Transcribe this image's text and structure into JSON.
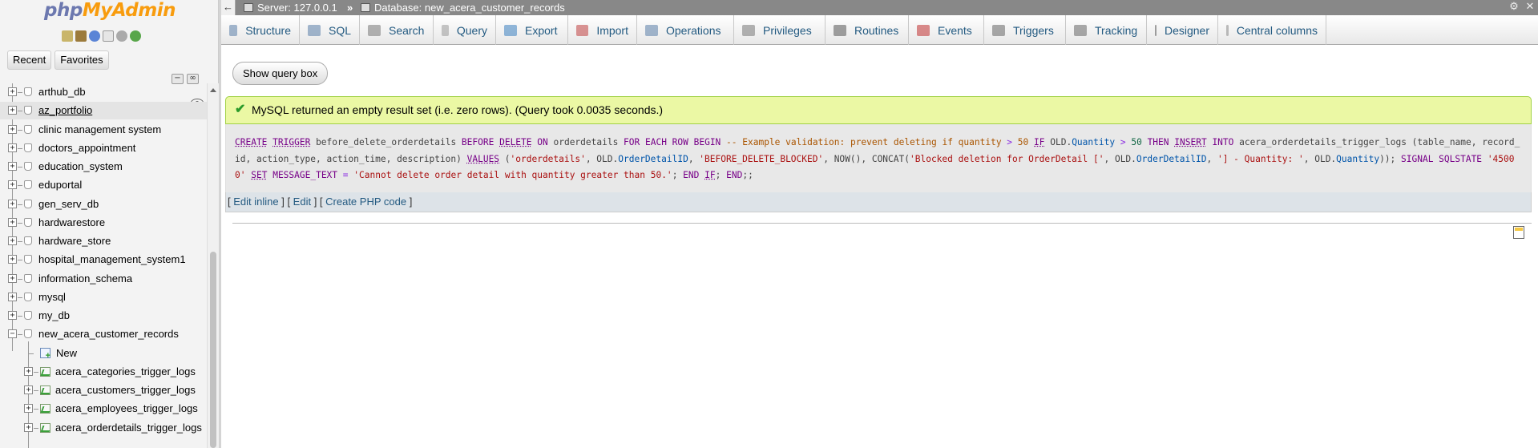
{
  "logo": {
    "part1": "php",
    "part2": "MyAdmin"
  },
  "nav": {
    "recent_label": "Recent",
    "favorites_label": "Favorites",
    "databases": [
      {
        "name": "arthub_db"
      },
      {
        "name": "az_portfolio"
      },
      {
        "name": "clinic management system"
      },
      {
        "name": "doctors_appointment"
      },
      {
        "name": "education_system"
      },
      {
        "name": "eduportal"
      },
      {
        "name": "gen_serv_db"
      },
      {
        "name": "hardwarestore"
      },
      {
        "name": "hardware_store"
      },
      {
        "name": "hospital_management_system1"
      },
      {
        "name": "information_schema"
      },
      {
        "name": "mysql"
      },
      {
        "name": "my_db"
      },
      {
        "name": "new_acera_customer_records"
      }
    ],
    "subitems": [
      {
        "name": "New"
      },
      {
        "name": "acera_categories_trigger_logs"
      },
      {
        "name": "acera_customers_trigger_logs"
      },
      {
        "name": "acera_employees_trigger_logs"
      },
      {
        "name": "acera_orderdetails_trigger_logs"
      }
    ],
    "collapse_glyph": "−",
    "link_glyph": "∞"
  },
  "serverbar": {
    "server": "Server: 127.0.0.1",
    "separator": "»",
    "database": "Database: new_acera_customer_records",
    "back_glyph": "←",
    "settings_glyph": "⚙",
    "collapse_glyph": "✕"
  },
  "tabs": [
    {
      "label": "Structure",
      "icon": "structure-icon",
      "color": "#5a7ea8"
    },
    {
      "label": "SQL",
      "icon": "sql-icon",
      "color": "#5a7ea8"
    },
    {
      "label": "Search",
      "icon": "search-icon",
      "color": "#777"
    },
    {
      "label": "Query",
      "icon": "query-icon",
      "color": "#999"
    },
    {
      "label": "Export",
      "icon": "export-icon",
      "color": "#3a7fbf"
    },
    {
      "label": "Import",
      "icon": "import-icon",
      "color": "#c04040"
    },
    {
      "label": "Operations",
      "icon": "wrench-icon",
      "color": "#5a7ea8"
    },
    {
      "label": "Privileges",
      "icon": "privileges-icon",
      "color": "#777"
    },
    {
      "label": "Routines",
      "icon": "routines-icon",
      "color": "#555"
    },
    {
      "label": "Events",
      "icon": "events-icon",
      "color": "#c03030"
    },
    {
      "label": "Triggers",
      "icon": "triggers-icon",
      "color": "#666"
    },
    {
      "label": "Tracking",
      "icon": "eye-icon",
      "color": "#666"
    },
    {
      "label": "Designer",
      "icon": "designer-icon",
      "color": "#555"
    },
    {
      "label": "Central columns",
      "icon": "central-columns-icon",
      "color": "#888"
    }
  ],
  "main": {
    "show_query_label": "Show query box",
    "success_message": "MySQL returned an empty result set (i.e. zero rows). (Query took 0.0035 seconds.)",
    "sql_links": {
      "edit_inline": "Edit inline",
      "edit": "Edit",
      "create_php": "Create PHP code"
    },
    "sql_tokens": [
      [
        "kwu",
        "CREATE"
      ],
      [
        " ",
        ""
      ],
      [
        "kwu",
        "TRIGGER"
      ],
      [
        "t",
        " before_delete_orderdetails "
      ],
      [
        "kw",
        "BEFORE"
      ],
      [
        "t",
        " "
      ],
      [
        "kwu",
        "DELETE"
      ],
      [
        "t",
        " "
      ],
      [
        "kw",
        "ON"
      ],
      [
        "t",
        " orderdetails "
      ],
      [
        "kw",
        "FOR EACH ROW BEGIN"
      ],
      [
        "t",
        " "
      ],
      [
        "cm",
        "-- Example validation: prevent deleting if quantity "
      ],
      [
        "op",
        ">"
      ],
      [
        "cm",
        " 50"
      ],
      [
        "t",
        " "
      ],
      [
        "kwu",
        "IF"
      ],
      [
        "t",
        " OLD."
      ],
      [
        "var",
        "Quantity"
      ],
      [
        "t",
        " "
      ],
      [
        "op",
        ">"
      ],
      [
        "t",
        " "
      ],
      [
        "num",
        "50"
      ],
      [
        "t",
        " "
      ],
      [
        "kw",
        "THEN"
      ],
      [
        "t",
        " "
      ],
      [
        "kwu",
        "INSERT"
      ],
      [
        "t",
        " "
      ],
      [
        "kw",
        "INTO"
      ],
      [
        "t",
        " acera_orderdetails_trigger_logs "
      ],
      [
        "t",
        "(table_name, record_id, action_type, action_time, description) "
      ],
      [
        "kwu",
        "VALUES"
      ],
      [
        "t",
        " ("
      ],
      [
        "str",
        "'orderdetails'"
      ],
      [
        "t",
        ", OLD."
      ],
      [
        "var",
        "OrderDetailID"
      ],
      [
        "t",
        ", "
      ],
      [
        "str",
        "'BEFORE_DELETE_BLOCKED'"
      ],
      [
        "t",
        ", NOW(), CONCAT("
      ],
      [
        "str",
        "'Blocked deletion for OrderDetail ['"
      ],
      [
        "t",
        ", OLD."
      ],
      [
        "var",
        "OrderDetailID"
      ],
      [
        "t",
        ", "
      ],
      [
        "str",
        "'] - Quantity: '"
      ],
      [
        "t",
        ", "
      ],
      [
        "t",
        "OLD."
      ],
      [
        "var",
        "Quantity"
      ],
      [
        "t",
        ")); "
      ],
      [
        "kw",
        "SIGNAL SQLSTATE"
      ],
      [
        "t",
        " "
      ],
      [
        "str",
        "'45000'"
      ],
      [
        "t",
        " "
      ],
      [
        "kwu",
        "SET"
      ],
      [
        "t",
        " "
      ],
      [
        "kw",
        "MESSAGE_TEXT"
      ],
      [
        "t",
        " "
      ],
      [
        "op",
        "="
      ],
      [
        "t",
        " "
      ],
      [
        "str",
        "'Cannot delete order detail with quantity greater than 50.'"
      ],
      [
        "t",
        "; "
      ],
      [
        "kw",
        "END"
      ],
      [
        "t",
        " "
      ],
      [
        "kwu",
        "IF"
      ],
      [
        "t",
        "; "
      ],
      [
        "kw",
        "END"
      ],
      [
        "t",
        ";;"
      ]
    ]
  }
}
